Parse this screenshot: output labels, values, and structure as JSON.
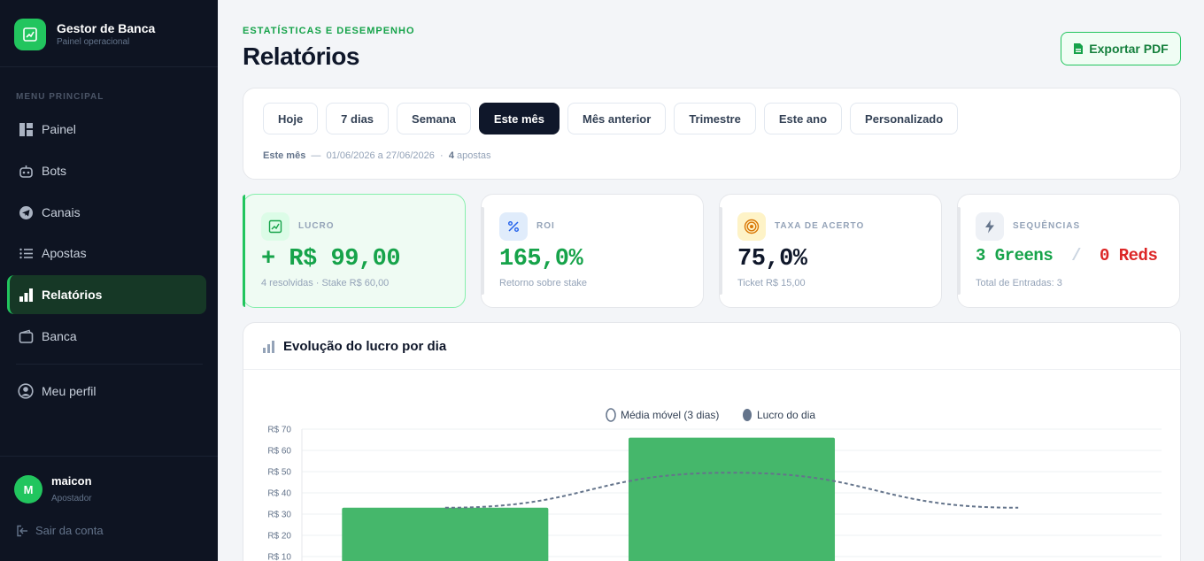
{
  "sidebar": {
    "brand_title": "Gestor de Banca",
    "brand_subtitle": "Painel operacional",
    "menu_heading": "MENU PRINCIPAL",
    "items": [
      {
        "label": "Painel",
        "icon": "dashboard-icon"
      },
      {
        "label": "Bots",
        "icon": "bot-icon"
      },
      {
        "label": "Canais",
        "icon": "telegram-icon"
      },
      {
        "label": "Apostas",
        "icon": "list-icon"
      },
      {
        "label": "Relatórios",
        "icon": "bar-chart-icon",
        "active": true
      },
      {
        "label": "Banca",
        "icon": "wallet-icon"
      }
    ],
    "profile_label": "Meu perfil",
    "user": {
      "initial": "M",
      "name": "maicon",
      "role": "Apostador"
    },
    "logout_label": "Sair da conta"
  },
  "header": {
    "kicker": "ESTATÍSTICAS E DESEMPENHO",
    "title": "Relatórios",
    "export_label": "Exportar PDF"
  },
  "filters": {
    "chips": [
      "Hoje",
      "7 dias",
      "Semana",
      "Este mês",
      "Mês anterior",
      "Trimestre",
      "Este ano",
      "Personalizado"
    ],
    "active": "Este mês",
    "range_name": "Este mês",
    "range_dates": "01/06/2026 a 27/06/2026",
    "range_count": "4",
    "range_count_label": "apostas"
  },
  "stats": {
    "lucro": {
      "label": "LUCRO",
      "value": "+ R$ 99,00",
      "foot": "4 resolvidas · Stake R$ 60,00"
    },
    "roi": {
      "label": "ROI",
      "value": "165,0%",
      "foot": "Retorno sobre stake"
    },
    "taxa": {
      "label": "TAXA DE ACERTO",
      "value": "75,0%",
      "foot": "Ticket R$ 15,00"
    },
    "sequencias": {
      "label": "SEQUÊNCIAS",
      "greens": "3 Greens",
      "separator": "/",
      "reds": "0 Reds",
      "foot": "Total de Entradas: 3"
    }
  },
  "chart_section": {
    "title": "Evolução do lucro por dia"
  },
  "colors": {
    "accent": "#22c55e",
    "dark": "#0f172a",
    "red": "#dc2626",
    "bar": "#45b76b",
    "line": "#64748b"
  },
  "chart_data": {
    "type": "bar",
    "categories": [
      "",
      "",
      ""
    ],
    "series": [
      {
        "name": "Lucro do dia",
        "type": "bar",
        "values": [
          33,
          66,
          null
        ]
      },
      {
        "name": "Média móvel (3 dias)",
        "type": "line",
        "values": [
          33,
          49.5,
          33
        ]
      }
    ],
    "ylim": [
      0,
      70
    ],
    "y_ticks": [
      "R$ 10",
      "R$ 20",
      "R$ 30",
      "R$ 40",
      "R$ 50",
      "R$ 60",
      "R$ 70"
    ],
    "legend": "top-center",
    "grid": true
  }
}
